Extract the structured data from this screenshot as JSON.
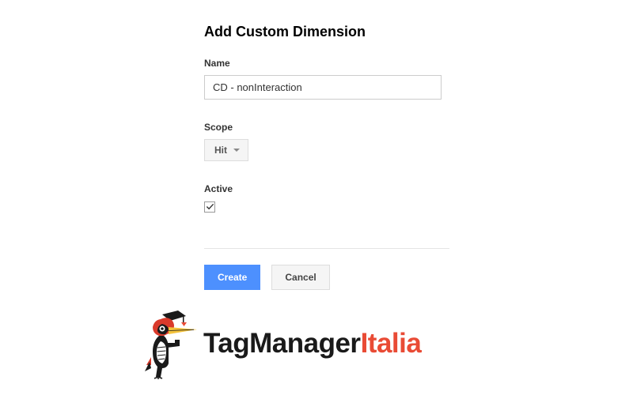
{
  "page": {
    "title": "Add Custom Dimension"
  },
  "form": {
    "name": {
      "label": "Name",
      "value": "CD - nonInteraction"
    },
    "scope": {
      "label": "Scope",
      "value": "Hit"
    },
    "active": {
      "label": "Active",
      "checked": true
    }
  },
  "buttons": {
    "create": "Create",
    "cancel": "Cancel"
  },
  "logo": {
    "text1": "TagManager",
    "text2": "Italia"
  }
}
